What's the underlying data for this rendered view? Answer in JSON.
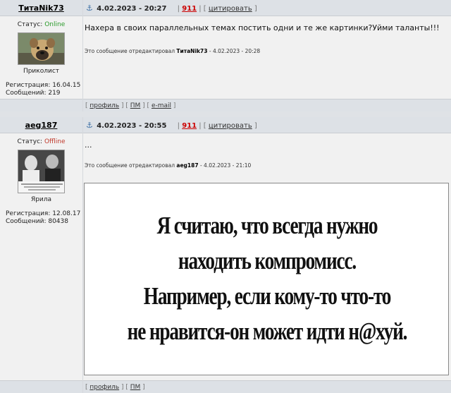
{
  "posts": [
    {
      "author": "ТитаNik73",
      "status_label": "Статус:",
      "status_value": "Online",
      "rank": "Приколист",
      "reg_label": "Регистрация:",
      "reg_date": "16.04.15",
      "msgs_label": "Сообщений:",
      "msgs_count": "219",
      "date": "4.02.2023 - 20:27",
      "post_num": "911",
      "quote_label": "цитировать",
      "text": "Нахера в своих параллельных темах постить одни и те же картинки?Уйми таланты!!!",
      "edited_prefix": "Это сообщение отредактировал",
      "edited_by": "ТитаNik73",
      "edited_at": "- 4.02.2023 - 20:28",
      "footer": {
        "profile": "профиль",
        "pm": "ПМ",
        "email": "e-mail"
      }
    },
    {
      "author": "aeg187",
      "status_label": "Статус:",
      "status_value": "Offline",
      "rank": "Ярила",
      "reg_label": "Регистрация:",
      "reg_date": "12.08.17",
      "msgs_label": "Сообщений:",
      "msgs_count": "80438",
      "date": "4.02.2023 - 20:55",
      "post_num": "911",
      "quote_label": "цитировать",
      "text": "...",
      "edited_prefix": "Это сообщение отредактировал",
      "edited_by": "aeg187",
      "edited_at": "- 4.02.2023 - 21:10",
      "meme_lines": [
        "Я считаю, что всегда нужно",
        "находить компромисс.",
        "Например,  если кому-то что-то",
        "не нравится-он может идти н@хуй."
      ],
      "footer": {
        "profile": "профиль",
        "pm": "ПМ"
      }
    }
  ],
  "icons": {
    "anchor": "anchor-icon"
  },
  "colors": {
    "online": "#2a9a2a",
    "offline": "#c0392b",
    "post_link": "#cc0000",
    "header_bg": "#dde1e6",
    "post_bg": "#f1f1f1"
  }
}
